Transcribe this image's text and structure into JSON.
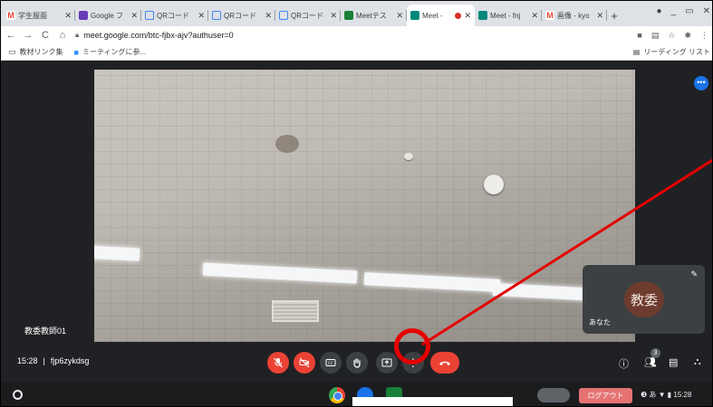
{
  "tabs": [
    {
      "title": "学生服面",
      "icon_color": "#ea4335",
      "glyph": "M"
    },
    {
      "title": "Google フ",
      "icon_color": "#673ab7",
      "glyph": "☰"
    },
    {
      "title": "QRコード",
      "icon_color": "#4285f4",
      "glyph": "C"
    },
    {
      "title": "QRコード",
      "icon_color": "#4285f4",
      "glyph": "C"
    },
    {
      "title": "QRコード",
      "icon_color": "#4285f4",
      "glyph": "C"
    },
    {
      "title": "Meetテス",
      "icon_color": "#188038",
      "glyph": "▣"
    },
    {
      "title": "Meet -",
      "icon_color": "#00897b",
      "glyph": "▶",
      "active": true
    },
    {
      "title": "Meet - fnj",
      "icon_color": "#00897b",
      "glyph": "▶"
    },
    {
      "title": "画像 - kyo",
      "icon_color": "#ea4335",
      "glyph": "M"
    }
  ],
  "new_tab": "+",
  "omnibox_url": "meet.google.com/btc-fjbx-ajv?authuser=0",
  "bookmarks": [
    {
      "label": "教材リンク集",
      "icon": "folder-icon"
    },
    {
      "label": "ミーティングに参...",
      "icon": "zoom-icon"
    }
  ],
  "reading_list": "リーディング リスト",
  "main_participant_name": "教委教師01",
  "self_tile": {
    "avatar_text": "教委",
    "name": "あなた",
    "avatar_color": "#6d3c2e"
  },
  "meeting": {
    "time": "15:28",
    "separator": "|",
    "code": "fjp6zykdsg"
  },
  "participants_count": "3",
  "shelf": {
    "logout_label": "ログアウト",
    "status_text": "❸ あ ▼ ▮ 15:28"
  }
}
